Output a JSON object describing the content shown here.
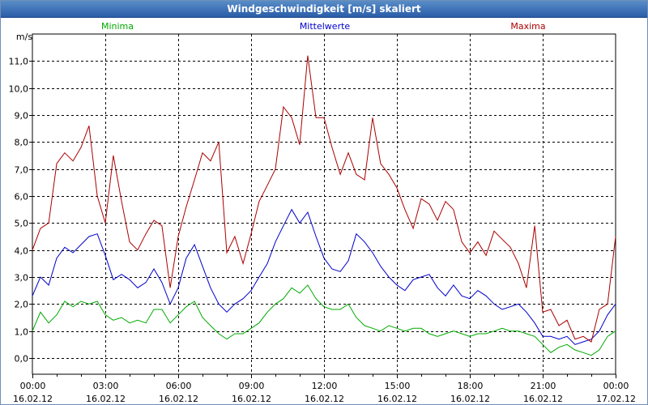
{
  "window": {
    "title": "Windgeschwindigkeit [m/s] skaliert"
  },
  "chart_data": {
    "type": "line",
    "title": "Windgeschwindigkeit [m/s] skaliert",
    "ylabel": "m/s",
    "ylim": [
      -0.6,
      12.0
    ],
    "xlim": [
      0,
      24
    ],
    "grid": true,
    "yticks": [
      0,
      1,
      2,
      3,
      4,
      5,
      6,
      7,
      8,
      9,
      10,
      11
    ],
    "ytick_labels": [
      "0,0",
      "1,0",
      "2,0",
      "3,0",
      "4,0",
      "5,0",
      "6,0",
      "7,0",
      "8,0",
      "9,0",
      "10,0",
      "11,0"
    ],
    "xticks": [
      0,
      3,
      6,
      9,
      12,
      15,
      18,
      21,
      24
    ],
    "xtick_labels": [
      {
        "time": "00:00",
        "date": "16.02.12"
      },
      {
        "time": "03:00",
        "date": "16.02.12"
      },
      {
        "time": "06:00",
        "date": "16.02.12"
      },
      {
        "time": "09:00",
        "date": "16.02.12"
      },
      {
        "time": "12:00",
        "date": "16.02.12"
      },
      {
        "time": "15:00",
        "date": "16.02.12"
      },
      {
        "time": "18:00",
        "date": "16.02.12"
      },
      {
        "time": "21:00",
        "date": "16.02.12"
      },
      {
        "time": "00:00",
        "date": "17.02.12"
      }
    ],
    "series": [
      {
        "name": "Minima",
        "color": "#00aa00",
        "x": [
          0,
          0.33,
          0.67,
          1,
          1.33,
          1.67,
          2,
          2.33,
          2.67,
          3,
          3.33,
          3.67,
          4,
          4.33,
          4.67,
          5,
          5.33,
          5.67,
          6,
          6.33,
          6.67,
          7,
          7.33,
          7.67,
          8,
          8.33,
          8.67,
          9,
          9.33,
          9.67,
          10,
          10.33,
          10.67,
          11,
          11.33,
          11.67,
          12,
          12.33,
          12.67,
          13,
          13.33,
          13.67,
          14,
          14.33,
          14.67,
          15,
          15.33,
          15.67,
          16,
          16.33,
          16.67,
          17,
          17.33,
          17.67,
          18,
          18.33,
          18.67,
          19,
          19.33,
          19.67,
          20,
          20.33,
          20.67,
          21,
          21.33,
          21.67,
          22,
          22.33,
          22.67,
          23,
          23.33,
          23.67,
          24
        ],
        "values": [
          1.0,
          1.7,
          1.3,
          1.6,
          2.1,
          1.9,
          2.1,
          2.0,
          2.1,
          1.6,
          1.4,
          1.5,
          1.3,
          1.4,
          1.3,
          1.8,
          1.8,
          1.3,
          1.6,
          1.9,
          2.1,
          1.5,
          1.2,
          0.9,
          0.7,
          0.9,
          0.9,
          1.1,
          1.3,
          1.7,
          2.0,
          2.2,
          2.6,
          2.4,
          2.7,
          2.2,
          1.9,
          1.8,
          1.8,
          2.0,
          1.5,
          1.2,
          1.1,
          1.0,
          1.2,
          1.1,
          1.0,
          1.1,
          1.1,
          0.9,
          0.8,
          0.9,
          1.0,
          0.9,
          0.8,
          0.9,
          0.9,
          1.0,
          1.1,
          1.0,
          1.0,
          0.9,
          0.8,
          0.5,
          0.2,
          0.4,
          0.5,
          0.3,
          0.2,
          0.1,
          0.3,
          0.8,
          1.0
        ]
      },
      {
        "name": "Mittelwerte",
        "color": "#0000cc",
        "x": [
          0,
          0.33,
          0.67,
          1,
          1.33,
          1.67,
          2,
          2.33,
          2.67,
          3,
          3.33,
          3.67,
          4,
          4.33,
          4.67,
          5,
          5.33,
          5.67,
          6,
          6.33,
          6.67,
          7,
          7.33,
          7.67,
          8,
          8.33,
          8.67,
          9,
          9.33,
          9.67,
          10,
          10.33,
          10.67,
          11,
          11.33,
          11.67,
          12,
          12.33,
          12.67,
          13,
          13.33,
          13.67,
          14,
          14.33,
          14.67,
          15,
          15.33,
          15.67,
          16,
          16.33,
          16.67,
          17,
          17.33,
          17.67,
          18,
          18.33,
          18.67,
          19,
          19.33,
          19.67,
          20,
          20.33,
          20.67,
          21,
          21.33,
          21.67,
          22,
          22.33,
          22.67,
          23,
          23.33,
          23.67,
          24
        ],
        "values": [
          2.3,
          3.0,
          2.7,
          3.7,
          4.1,
          3.9,
          4.2,
          4.5,
          4.6,
          3.8,
          2.9,
          3.1,
          2.9,
          2.6,
          2.8,
          3.3,
          2.8,
          2.0,
          2.6,
          3.7,
          4.2,
          3.4,
          2.6,
          2.0,
          1.7,
          2.0,
          2.2,
          2.5,
          3.0,
          3.5,
          4.3,
          4.9,
          5.5,
          5.0,
          5.4,
          4.5,
          3.7,
          3.3,
          3.2,
          3.6,
          4.6,
          4.3,
          3.9,
          3.4,
          3.0,
          2.7,
          2.5,
          2.9,
          3.0,
          3.1,
          2.6,
          2.3,
          2.7,
          2.3,
          2.2,
          2.5,
          2.3,
          2.0,
          1.8,
          1.9,
          2.0,
          1.7,
          1.3,
          0.8,
          0.8,
          0.7,
          0.8,
          0.5,
          0.6,
          0.7,
          1.0,
          1.6,
          2.0
        ]
      },
      {
        "name": "Maxima",
        "color": "#aa0000",
        "x": [
          0,
          0.33,
          0.67,
          1,
          1.33,
          1.67,
          2,
          2.33,
          2.67,
          3,
          3.33,
          3.67,
          4,
          4.33,
          4.67,
          5,
          5.33,
          5.67,
          6,
          6.33,
          6.67,
          7,
          7.33,
          7.67,
          8,
          8.33,
          8.67,
          9,
          9.33,
          9.67,
          10,
          10.33,
          10.67,
          11,
          11.33,
          11.67,
          12,
          12.33,
          12.67,
          13,
          13.33,
          13.67,
          14,
          14.33,
          14.67,
          15,
          15.33,
          15.67,
          16,
          16.33,
          16.67,
          17,
          17.33,
          17.67,
          18,
          18.33,
          18.67,
          19,
          19.33,
          19.67,
          20,
          20.33,
          20.67,
          21,
          21.33,
          21.67,
          22,
          22.33,
          22.67,
          23,
          23.33,
          23.67,
          24
        ],
        "values": [
          4.0,
          4.8,
          5.0,
          7.2,
          7.6,
          7.3,
          7.8,
          8.6,
          6.0,
          5.0,
          7.5,
          5.8,
          4.3,
          4.0,
          4.6,
          5.1,
          4.9,
          2.6,
          4.5,
          5.6,
          6.6,
          7.6,
          7.3,
          8.0,
          3.9,
          4.5,
          3.5,
          4.6,
          5.8,
          6.4,
          7.0,
          9.3,
          8.9,
          7.9,
          11.2,
          8.9,
          8.9,
          7.8,
          6.8,
          7.6,
          6.8,
          6.6,
          8.9,
          7.2,
          6.8,
          6.3,
          5.5,
          4.8,
          5.9,
          5.7,
          5.1,
          5.8,
          5.5,
          4.3,
          3.9,
          4.3,
          3.8,
          4.7,
          4.4,
          4.1,
          3.5,
          2.6,
          4.9,
          1.7,
          1.8,
          1.2,
          1.4,
          0.7,
          0.8,
          0.6,
          1.8,
          2.0,
          4.5
        ]
      }
    ]
  }
}
